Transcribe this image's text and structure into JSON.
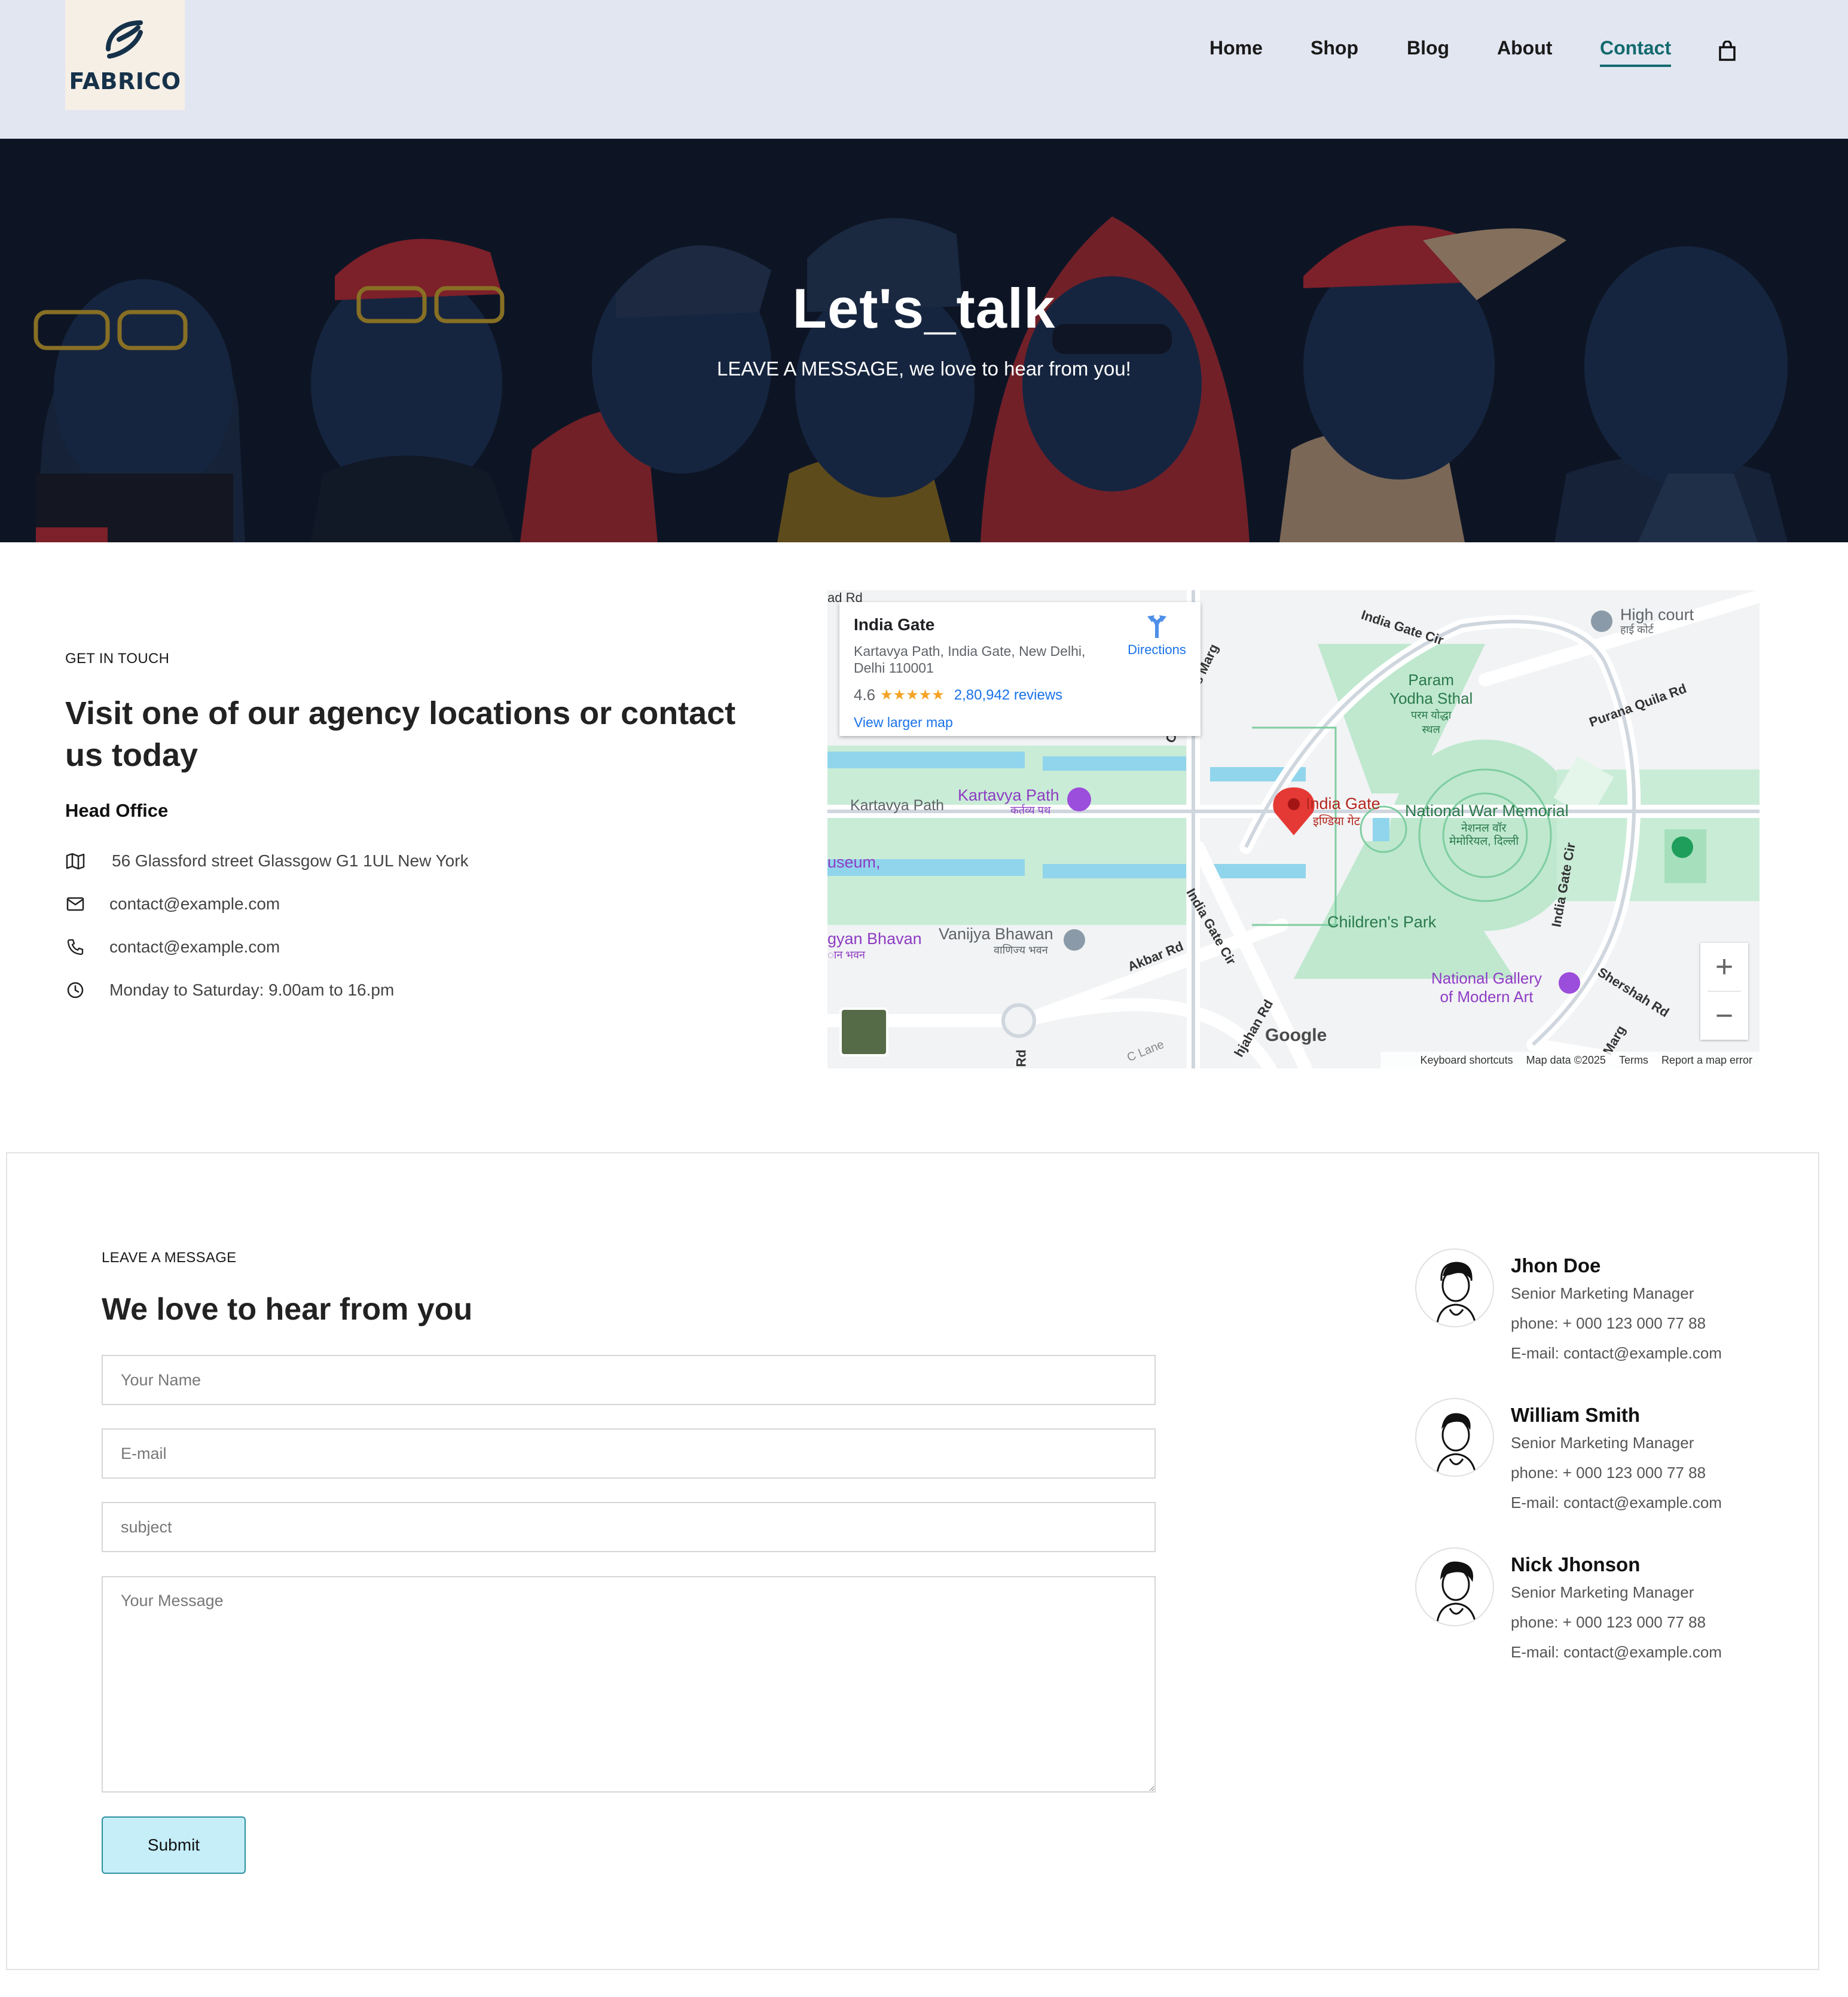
{
  "brand": {
    "name": "FABRICO"
  },
  "nav": {
    "items": [
      {
        "label": "Home",
        "active": false
      },
      {
        "label": "Shop",
        "active": false
      },
      {
        "label": "Blog",
        "active": false
      },
      {
        "label": "About",
        "active": false
      },
      {
        "label": "Contact",
        "active": true
      }
    ],
    "cart_icon": "shopping-bag-icon"
  },
  "hero": {
    "title": "Let's_talk",
    "subtitle": "LEAVE A MESSAGE, we love to hear from you!"
  },
  "contact": {
    "eyebrow": "GET IN TOUCH",
    "heading_line1": "Visit one of our agency locations or contact",
    "heading_line2": "us today",
    "office_title": "Head Office",
    "address": "56 Glassford street Glassgow G1 1UL New York",
    "email": "contact@example.com",
    "phone": "contact@example.com",
    "hours": "Monday to Saturday: 9.00am to 16.pm"
  },
  "map": {
    "place_name": "India Gate",
    "place_address_line1": "Kartavya Path, India Gate, New Delhi,",
    "place_address_line2": "Delhi 110001",
    "rating": "4.6",
    "stars": "★★★★★",
    "reviews": "2,80,942 reviews",
    "view_larger": "View larger map",
    "directions": "Directions",
    "labels": {
      "india_gate": "India Gate",
      "india_gate_hi": "इण्डिया गेट",
      "param_yodha": "Param",
      "param_yodha2": "Yodha Sthal",
      "param_yodha_hi": "परम योद्धा",
      "param_yodha_hi2": "स्थल",
      "national_war": "National War Memorial",
      "national_war_hi": "नेशनल वॉर",
      "national_war_hi2": "मेमोरियल, दिल्ली",
      "kartavya_path": "Kartavya Path",
      "kartavya_path_hi": "कर्तव्य पथ",
      "kartavya_road": "Kartavya Path",
      "childrens_park": "Children's Park",
      "national_gallery": "National Gallery",
      "national_gallery2": "of Modern Art",
      "vanijya": "Vanijya Bhawan",
      "vanijya_hi": "वाणिज्य भवन",
      "gyan": "gyan Bhavan",
      "gyan_hi": "ान भवन",
      "useum": "useum,",
      "high_court": "High court",
      "high_court_hi": "हाई कोर्ट",
      "purana_quila": "Purana Quila Rd",
      "india_gate_cir": "India Gate Cir",
      "copernicus": "Copernicus Marg",
      "akbar": "Akbar Rd",
      "shershah": "Shershah Rd",
      "shahjahan": "hjahan Rd",
      "sc_lane": "C Lane",
      "ad_rd": "ad Rd",
      "rd": "Rd",
      "marg": "Marg"
    },
    "footer": {
      "shortcuts": "Keyboard shortcuts",
      "data": "Map data ©2025",
      "terms": "Terms",
      "report": "Report a map error"
    },
    "google": "Google",
    "zoom_in": "+",
    "zoom_out": "−"
  },
  "form": {
    "eyebrow": "LEAVE A MESSAGE",
    "heading": "We love to hear from you",
    "name_placeholder": "Your Name",
    "email_placeholder": "E-mail",
    "subject_placeholder": "subject",
    "message_placeholder": "Your Message",
    "submit": "Submit"
  },
  "team": [
    {
      "name": "Jhon Doe",
      "role": "Senior Marketing Manager",
      "phone": "phone: + 000 123 000 77 88",
      "email": "E-mail: contact@example.com"
    },
    {
      "name": "William Smith",
      "role": "Senior Marketing Manager",
      "phone": "phone: + 000 123 000 77 88",
      "email": "E-mail: contact@example.com"
    },
    {
      "name": "Nick Jhonson",
      "role": "Senior Marketing Manager",
      "phone": "phone: + 000 123 000 77 88",
      "email": "E-mail: contact@example.com"
    }
  ]
}
